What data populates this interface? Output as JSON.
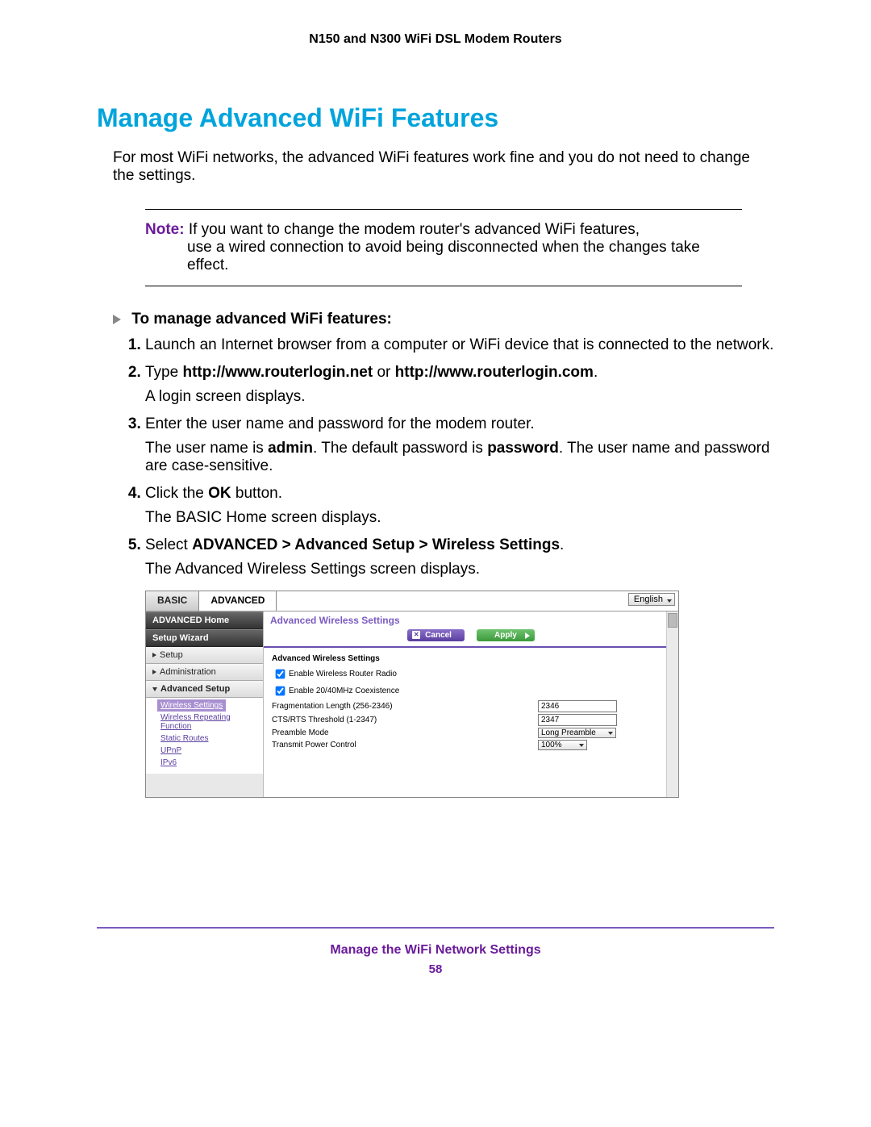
{
  "doc_header": "N150 and N300 WiFi DSL Modem Routers",
  "section_title": "Manage Advanced WiFi Features",
  "intro": "For most WiFi networks, the advanced WiFi features work fine and you do not need to change the settings.",
  "note": {
    "label": "Note:",
    "first_line": "If you want to change the modem router's advanced WiFi features,",
    "rest": "use a wired connection to avoid being disconnected when the changes take effect."
  },
  "proc_heading": "To manage advanced WiFi features:",
  "steps": {
    "s1": "Launch an Internet browser from a computer or WiFi device that is connected to the network.",
    "s2_pre": "Type ",
    "s2_url1": "http://www.routerlogin.net",
    "s2_mid": " or ",
    "s2_url2": "http://www.routerlogin.com",
    "s2_post": ".",
    "s2_p": "A login screen displays.",
    "s3": "Enter the user name and password for the modem router.",
    "s3_p_a": "The user name is ",
    "s3_admin": "admin",
    "s3_p_b": ". The default password is ",
    "s3_pw": "password",
    "s3_p_c": ". The user name and password are case-sensitive.",
    "s4_a": "Click the ",
    "s4_ok": "OK",
    "s4_b": " button.",
    "s4_p": "The BASIC Home screen displays.",
    "s5_a": "Select ",
    "s5_path": "ADVANCED > Advanced Setup > Wireless Settings",
    "s5_b": ".",
    "s5_p": "The Advanced Wireless Settings screen displays."
  },
  "screenshot": {
    "tabs": {
      "basic": "BASIC",
      "advanced": "ADVANCED"
    },
    "language": "English",
    "sidebar": {
      "adv_home": "ADVANCED Home",
      "setup_wizard": "Setup Wizard",
      "setup": "Setup",
      "administration": "Administration",
      "advanced_setup": "Advanced Setup",
      "links": {
        "wireless_settings": "Wireless Settings",
        "wireless_repeating": "Wireless Repeating Function",
        "static_routes": "Static Routes",
        "upnp": "UPnP",
        "ipv6": "IPv6"
      }
    },
    "panel_title": "Advanced Wireless Settings",
    "buttons": {
      "cancel": "Cancel",
      "apply": "Apply"
    },
    "form_title": "Advanced Wireless Settings",
    "fields": {
      "enable_radio": "Enable Wireless Router Radio",
      "enable_coexist": "Enable 20/40MHz Coexistence",
      "frag_label": "Fragmentation Length (256-2346)",
      "frag_value": "2346",
      "cts_label": "CTS/RTS Threshold (1-2347)",
      "cts_value": "2347",
      "preamble_label": "Preamble Mode",
      "preamble_value": "Long Preamble",
      "tx_label": "Transmit Power Control",
      "tx_value": "100%"
    }
  },
  "footer_title": "Manage the WiFi Network Settings",
  "footer_page": "58"
}
